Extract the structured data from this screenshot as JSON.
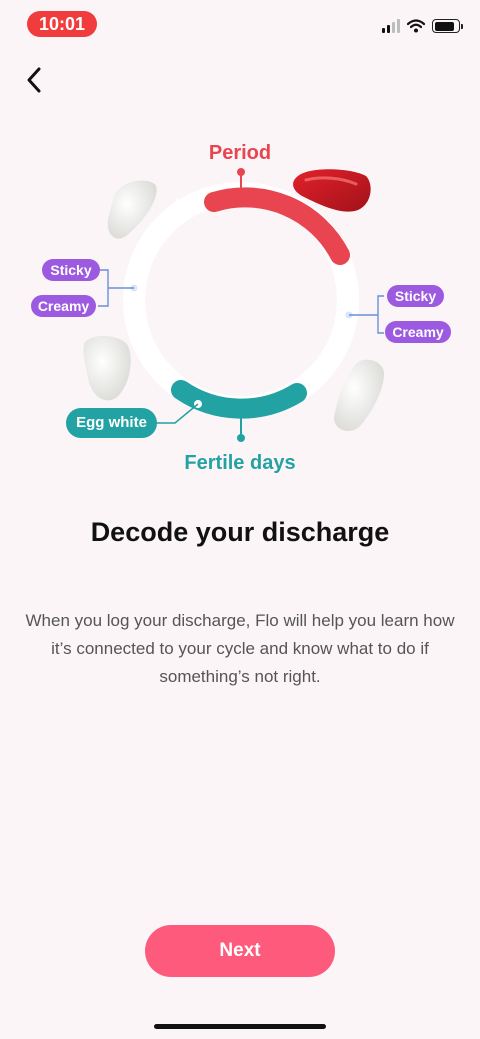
{
  "status_bar": {
    "time": "10:01"
  },
  "nav": {
    "back_icon": "chevron-left-icon"
  },
  "illustration": {
    "period_label": "Period",
    "fertile_label": "Fertile days",
    "left_labels": [
      "Sticky",
      "Creamy"
    ],
    "right_labels": [
      "Sticky",
      "Creamy"
    ],
    "egg_white_label": "Egg white",
    "colors": {
      "period": "#e84550",
      "fertile": "#23a2a4",
      "consistency": "#9c5ae0"
    }
  },
  "content": {
    "title": "Decode your discharge",
    "body": "When you log your discharge, Flo will help you learn how it’s connected to your cycle and know what to do if something’s not right."
  },
  "footer": {
    "next_label": "Next",
    "next_color": "#fd5a7c"
  }
}
